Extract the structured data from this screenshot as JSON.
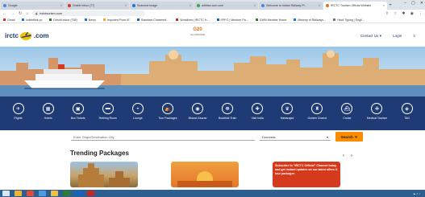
{
  "browser": {
    "tabs": [
      {
        "label": "Google",
        "color": "#4285f4"
      },
      {
        "label": "Drishti Inbox (77)",
        "color": "#d93025"
      },
      {
        "label": "Scanned Image",
        "color": "#1a73e8"
      },
      {
        "label": "adithse.com.com",
        "color": "#34a853"
      },
      {
        "label": "Welcome to Indian Railway Pl...",
        "color": "#4285f4"
      },
      {
        "label": "IRCTC Tourism Official Website",
        "color": "#e37222"
      }
    ],
    "url": "irctctourism.com",
    "bookmarks": [
      {
        "label": "Gmail",
        "color": "#d93025"
      },
      {
        "label": "indentlink.pc",
        "color": "#1a73e8"
      },
      {
        "label": "Drishti Inbox (738)",
        "color": "#2e7d32"
      },
      {
        "label": "News",
        "color": "#1a73e8"
      },
      {
        "label": "Imported From IE",
        "color": "#f9a825"
      },
      {
        "label": "Standard Chartered...",
        "color": "#1565c0"
      },
      {
        "label": "Worklines | IRCTC H...",
        "color": "#c62828"
      },
      {
        "label": "EPFO | Member Pa...",
        "color": "#1565c0"
      },
      {
        "label": "GWN Member Home",
        "color": "#2e7d32"
      },
      {
        "label": "Ministry of Railways...",
        "color": "#1a73e8"
      },
      {
        "label": "Hindi Typing | Engli...",
        "color": "#777777"
      }
    ]
  },
  "site": {
    "logo_left": "irctc",
    "logo_right": ".com",
    "g20_text": "G20",
    "g20_sub": "भारत 2023 INDIA",
    "contact": "Contact Us",
    "login": "Login",
    "menu_icon": "hamburger-icon",
    "services": [
      {
        "label": "Flights",
        "icon": "✈"
      },
      {
        "label": "Hotels",
        "icon": "▦"
      },
      {
        "label": "Bus Tickets",
        "icon": "▣"
      },
      {
        "label": "Retiring Room",
        "icon": "▬"
      },
      {
        "label": "Lounge",
        "icon": "◒"
      },
      {
        "label": "Tour Packages",
        "icon": "⛺"
      },
      {
        "label": "Bharat Gaurav",
        "icon": "◉"
      },
      {
        "label": "Buddhist Train",
        "icon": "☸"
      },
      {
        "label": "Visit India",
        "icon": "✚"
      },
      {
        "label": "Maharajas'",
        "icon": "♛"
      },
      {
        "label": "Golden Chariot",
        "icon": "♜"
      },
      {
        "label": "Cruise",
        "icon": "⛴"
      },
      {
        "label": "Medical Tourism",
        "icon": "✙"
      },
      {
        "label": "TAG",
        "icon": "◈"
      }
    ],
    "search_placeholder": "Enter Origin/Destination City",
    "search_type": "Domestic",
    "search_button": "Search",
    "trending_title": "Trending Packages",
    "promo_text": "Subscribe to \"IRCTC Official\" Channel today and get instant updates on our latest offers & tour packages"
  }
}
